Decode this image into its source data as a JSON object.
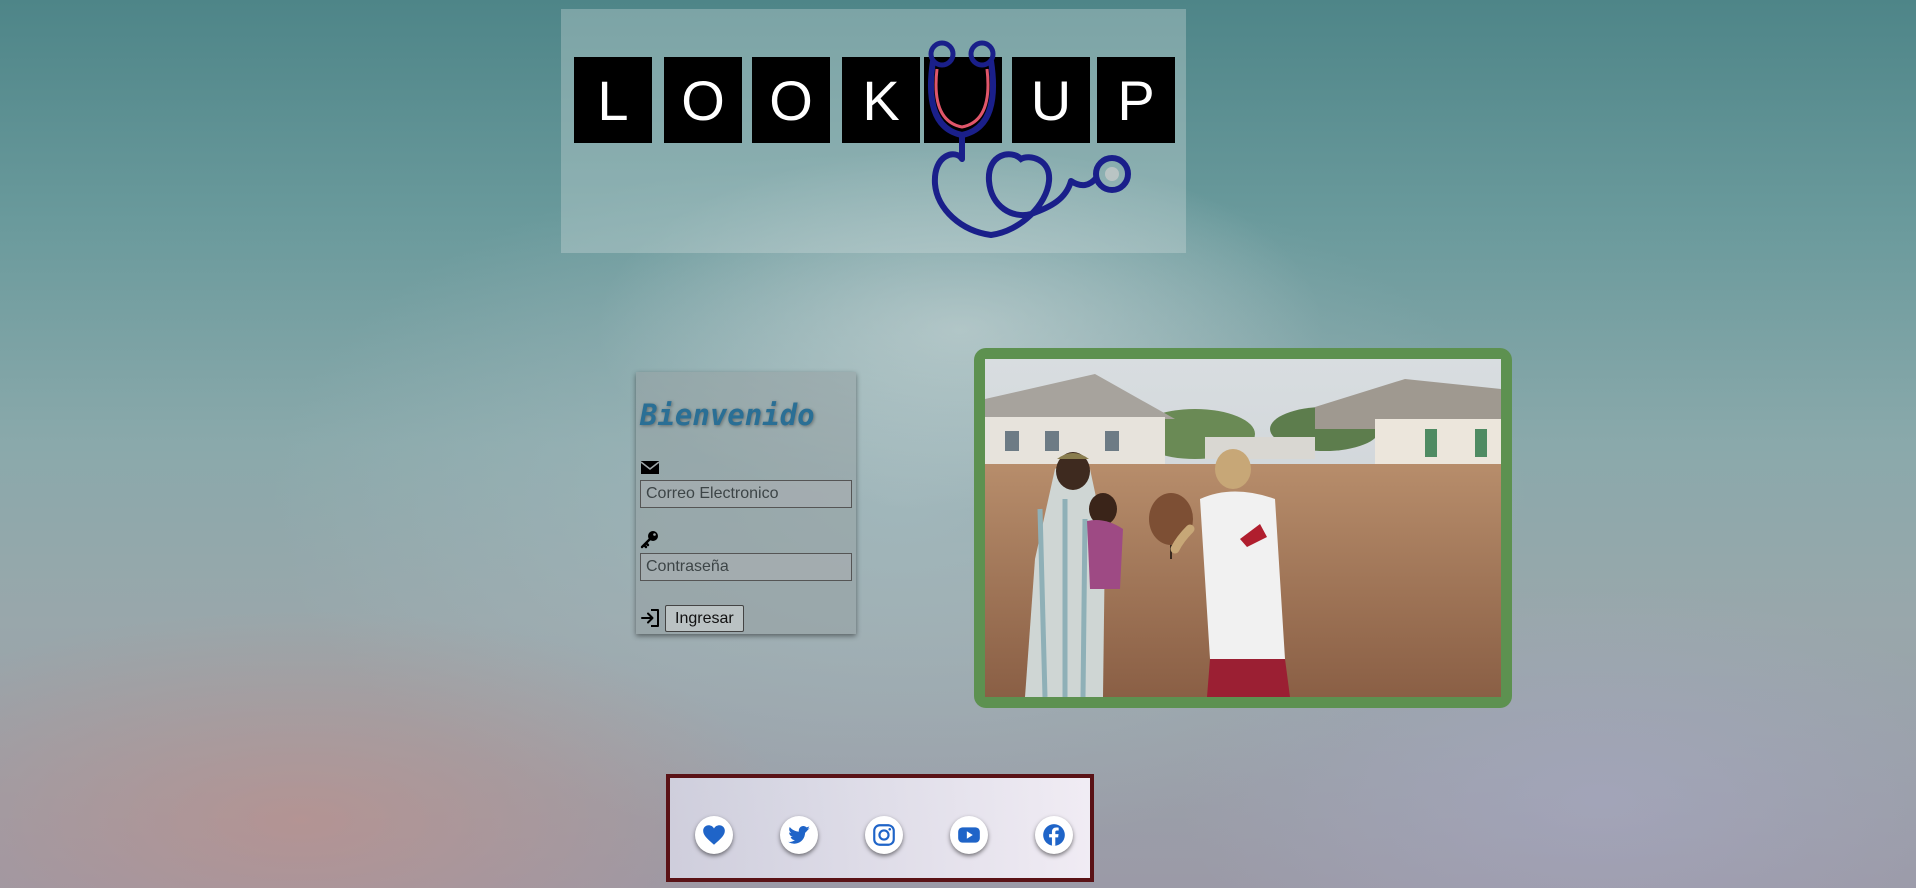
{
  "logo": {
    "letters": [
      "L",
      "O",
      "O",
      "K",
      "U",
      "P"
    ],
    "colors": {
      "tile": "#000000",
      "stethoscope": "#1a1f8a",
      "accent": "#e0566a"
    }
  },
  "login": {
    "title": "Bienvenido",
    "email": {
      "icon": "envelope-icon",
      "placeholder": "Correo Electronico",
      "value": ""
    },
    "password": {
      "icon": "key-icon",
      "placeholder": "Contraseña",
      "value": ""
    },
    "submit": {
      "icon": "sign-in-icon",
      "label": "Ingresar"
    },
    "title_color": "#2a6f95"
  },
  "photo": {
    "icon": "photo",
    "border_color": "#5d9150"
  },
  "social": {
    "border_color": "#5a1216",
    "icon_color": "#1f64c8",
    "links": [
      {
        "icon": "heart-icon"
      },
      {
        "icon": "twitter-icon"
      },
      {
        "icon": "instagram-icon"
      },
      {
        "icon": "youtube-icon"
      },
      {
        "icon": "facebook-icon"
      }
    ]
  }
}
